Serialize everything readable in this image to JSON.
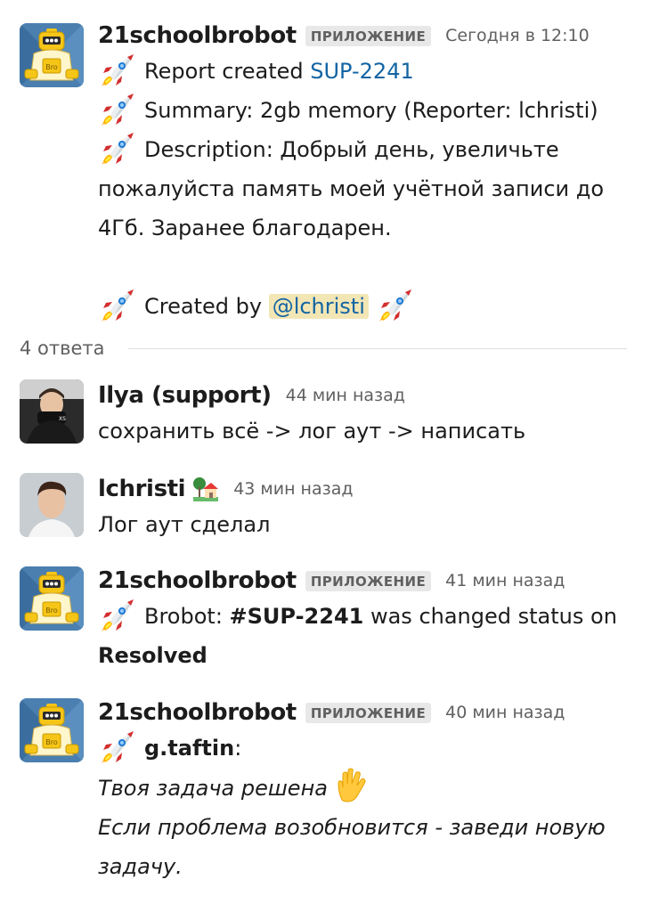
{
  "thread": {
    "root": {
      "author": "21schoolbrobot",
      "badge": "ПРИЛОЖЕНИЕ",
      "time": "Сегодня в 12:10",
      "report_prefix": "Report created",
      "report_link": "SUP-2241",
      "summary": "Summary: 2gb memory (Reporter: lchristi)",
      "description": "Description: Добрый день, увеличьте пожалуйста память моей учётной записи до 4Гб. Заранее благодарен.",
      "created_by_prefix": "Created by",
      "created_by_mention": "@lchristi"
    },
    "replies_count": "4 ответа",
    "replies": [
      {
        "author": "Ilya (support)",
        "time": "44 мин назад",
        "text": "сохранить всё -> лог аут -> написать"
      },
      {
        "author": "lchristi",
        "status_icon": "house-with-garden-icon",
        "time": "43 мин назад",
        "text": "Лог аут сделал"
      },
      {
        "author": "21schoolbrobot",
        "badge": "ПРИЛОЖЕНИЕ",
        "time": "41 мин назад",
        "prefix": "Brobot: ",
        "ticket": "#SUP-2241",
        "middle": " was changed status on ",
        "status": "Resolved"
      },
      {
        "author": "21schoolbrobot",
        "badge": "ПРИЛОЖЕНИЕ",
        "time": "40 мин назад",
        "user": "g.taftin",
        "user_suffix": ":",
        "line1": "Твоя задача решена",
        "line2": "Если проблема возобновится - заведи новую задачу."
      }
    ]
  },
  "icons": {
    "rocket": "rocket-icon",
    "hand": "vulcan-salute-icon",
    "house": "house-with-garden-icon"
  },
  "colors": {
    "link": "#1264a3",
    "mention_bg": "#f2e6b5",
    "badge_bg": "#e8e8e8",
    "meta": "#616061"
  }
}
